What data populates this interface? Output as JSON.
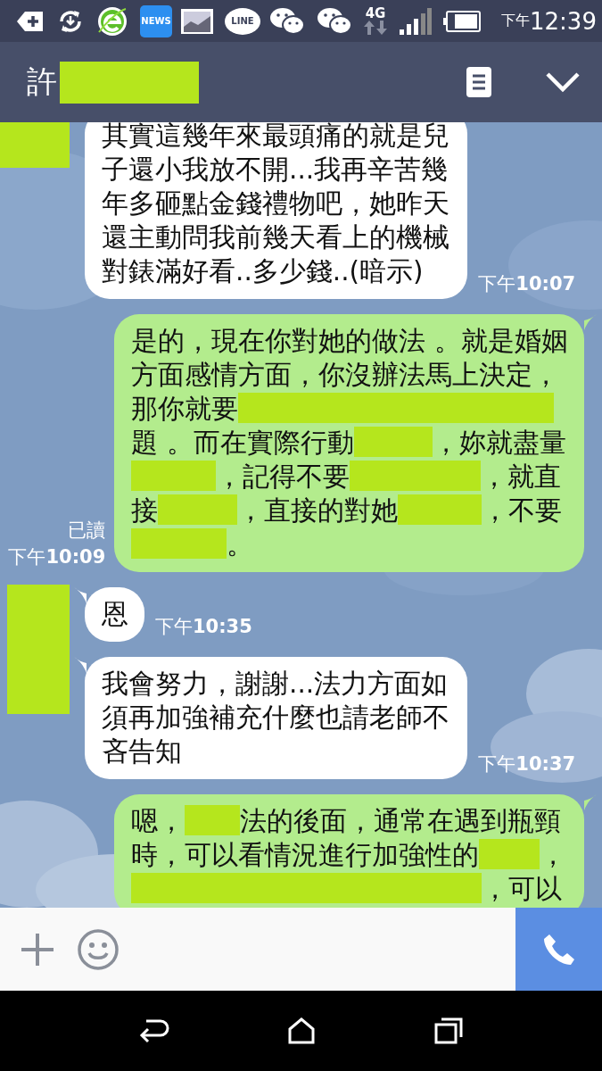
{
  "status_bar": {
    "news_label": "NEWS",
    "line_label": "LINE",
    "network": "4G",
    "ampm": "下午",
    "time": "12:39"
  },
  "header": {
    "title": "許",
    "title_redacted": true
  },
  "messages": [
    {
      "kind": "received",
      "avatar": true,
      "segments": [
        {
          "kind": "text",
          "text": "其實這幾年來最頭痛的就是兒子還小我放不開...我再辛苦幾年多砸點金錢禮物吧，她昨天還主動問我前幾天看上的機械對錶滿好看..多少錢..(暗示)"
        }
      ],
      "time": "下午**10:07**"
    },
    {
      "kind": "sent",
      "segments": [
        {
          "kind": "text",
          "text": "是的，現在你對她的做法 。就是婚姻"
        },
        {
          "kind": "text",
          "text": "方面感情方面，你沒辦法馬上決定，"
        },
        {
          "kind": "text",
          "text": "那你就要"
        },
        {
          "kind": "redaction"
        },
        {
          "kind": "text",
          "text": "題 。而在實際行動"
        },
        {
          "kind": "redaction"
        },
        {
          "kind": "text",
          "text": "，妳就盡量"
        },
        {
          "kind": "redaction"
        },
        {
          "kind": "text",
          "text": "，記得不要"
        },
        {
          "kind": "redaction"
        },
        {
          "kind": "text",
          "text": "，就直"
        },
        {
          "kind": "text",
          "text": "接"
        },
        {
          "kind": "redaction"
        },
        {
          "kind": "text",
          "text": "，直接的對她"
        },
        {
          "kind": "redaction"
        },
        {
          "kind": "text",
          "text": "，不要"
        },
        {
          "kind": "redaction"
        },
        {
          "kind": "text",
          "text": "。"
        }
      ],
      "read": "已讀",
      "time": "下午**10:09**"
    },
    {
      "kind": "received",
      "avatar": true,
      "segments": [
        {
          "kind": "text",
          "text": "恩"
        }
      ],
      "time": "下午**10:35**"
    },
    {
      "kind": "received",
      "segments": [
        {
          "kind": "text",
          "text": "我會努力，謝謝...法力方面如須再加強補充什麼也請老師不吝告知"
        }
      ],
      "time": "下午**10:37**"
    },
    {
      "kind": "sent",
      "segments": [
        {
          "kind": "text",
          "text": "嗯，"
        },
        {
          "kind": "redaction"
        },
        {
          "kind": "text",
          "text": "法的後面，通常在遇到瓶頸"
        },
        {
          "kind": "text",
          "text": "時，可以看情況進行加強性的"
        },
        {
          "kind": "redaction"
        },
        {
          "kind": "text",
          "text": "，"
        },
        {
          "kind": "redaction"
        },
        {
          "kind": "text",
          "text": "，可以"
        }
      ]
    }
  ]
}
